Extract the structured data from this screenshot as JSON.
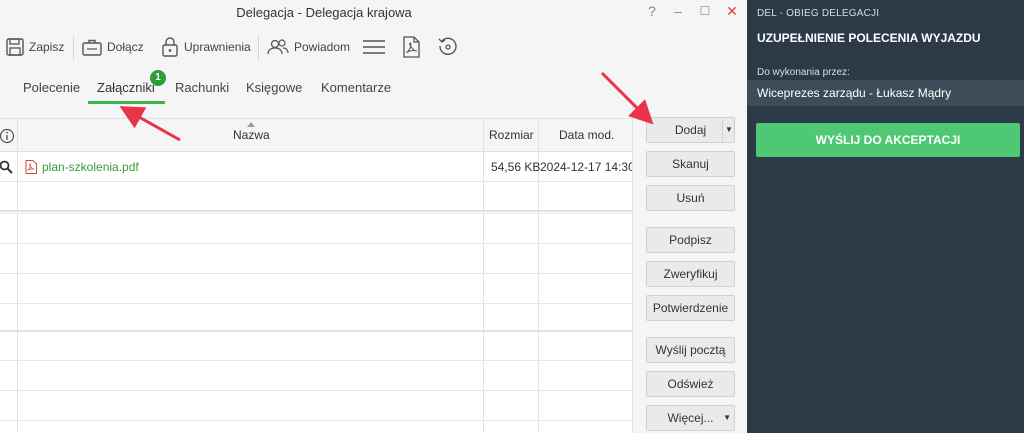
{
  "window": {
    "title": "Delegacja - Delegacja krajowa",
    "help": "?",
    "minimize": "–",
    "maximize": "☐",
    "close": "✕"
  },
  "toolbar": {
    "save": "Zapisz",
    "attach": "Dołącz",
    "permissions": "Uprawnienia",
    "notify": "Powiadom"
  },
  "tabs": [
    {
      "label": "Polecenie"
    },
    {
      "label": "Załączniki",
      "active": true,
      "badge": "1"
    },
    {
      "label": "Rachunki"
    },
    {
      "label": "Księgowe"
    },
    {
      "label": "Komentarze"
    }
  ],
  "table": {
    "columns": {
      "name": "Nazwa",
      "size": "Rozmiar",
      "date": "Data mod."
    },
    "rows": [
      {
        "name": "plan-szkolenia.pdf",
        "size": "54,56 KB",
        "date": "2024-12-17 14:30"
      }
    ]
  },
  "actions": {
    "add": "Dodaj",
    "scan": "Skanuj",
    "delete": "Usuń",
    "sign": "Podpisz",
    "verify": "Zweryfikuj",
    "confirm": "Potwierdzenie",
    "send_mail": "Wyślij pocztą",
    "refresh": "Odśwież",
    "more": "Więcej..."
  },
  "panel": {
    "header": "DEL - OBIEG DELEGACJI",
    "title": "UZUPEŁNIENIE POLECENIA WYJAZDU",
    "assigned_label": "Do wykonania przez:",
    "assignee": "Wiceprezes zarządu - Łukasz Mądry",
    "send_button": "WYŚLIJ DO AKCEPTACJI"
  },
  "colors": {
    "accent_green": "#3bb54a",
    "panel_bg": "#2c3a47",
    "send_button": "#4fc874",
    "annotation_arrow": "#e8334a"
  }
}
